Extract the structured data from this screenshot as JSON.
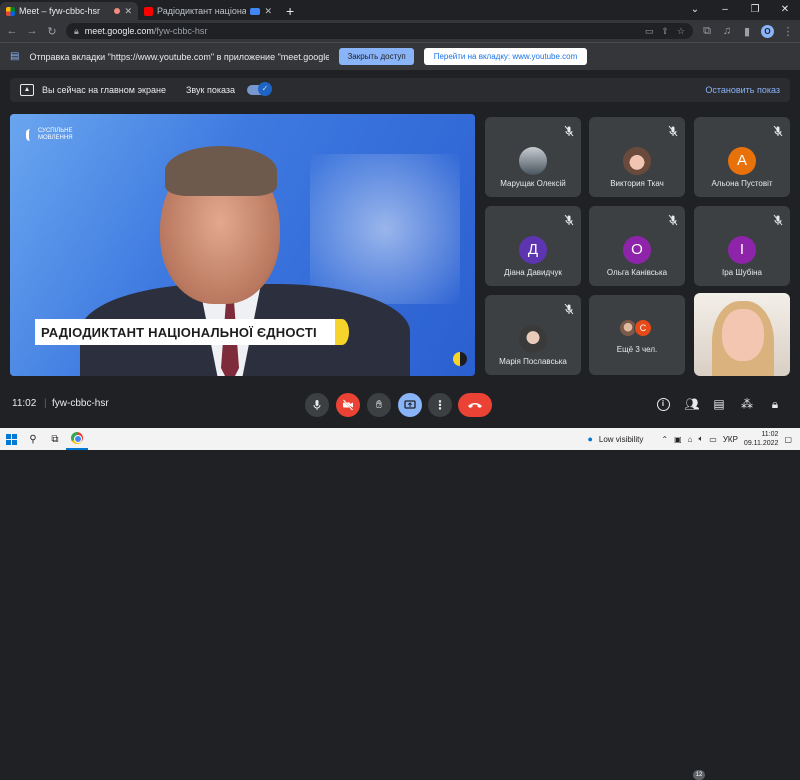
{
  "browser": {
    "tabs": [
      {
        "title": "Meet – fyw-cbbc-hsr",
        "active": true,
        "favicon": "meet-icon"
      },
      {
        "title": "Радіодиктант національної",
        "active": false,
        "favicon": "youtube-icon"
      }
    ],
    "new_tab_label": "+",
    "address": {
      "host": "meet.google.com",
      "path": "/fyw-cbbc-hsr"
    },
    "profile_initial": "O"
  },
  "infobar": {
    "message": "Отправка вкладки \"https://www.youtube.com\" в приложение \"meet.google.com\"...",
    "stop_label": "Закрыть доступ",
    "switch_label": "Перейти на вкладку: www.youtube.com"
  },
  "presenting": {
    "status": "Вы сейчас на главном экране",
    "audio_label": "Звук показа",
    "audio_on": true,
    "stop_label": "Остановить показ"
  },
  "stage": {
    "channel_logo": [
      "СУСПІЛЬНЕ",
      "МОВЛЕННЯ"
    ],
    "caption": "РАДІОДИКТАНТ НАЦІОНАЛЬНОЇ ЄДНОСТІ"
  },
  "participants": [
    {
      "name": "Марущак Олексій",
      "avatar": "photo",
      "color": "#5b6b7a",
      "muted": true
    },
    {
      "name": "Виктория Ткач",
      "avatar": "photo",
      "color": "#b08a7a",
      "muted": true
    },
    {
      "name": "Альона Пустовіт",
      "avatar": "А",
      "color": "#e8710a",
      "muted": true
    },
    {
      "name": "Діана Давидчук",
      "avatar": "Д",
      "color": "#5e35b1",
      "muted": true
    },
    {
      "name": "Ольга Канівська",
      "avatar": "О",
      "color": "#8e24aa",
      "muted": true
    },
    {
      "name": "Іра Шубіна",
      "avatar": "І",
      "color": "#8e24aa",
      "muted": true
    },
    {
      "name": "Марія Пославська",
      "avatar": "photo",
      "color": "#9a8a80",
      "muted": true
    }
  ],
  "more_tile": {
    "label": "Ещё 3 чел.",
    "avatar_letter": "С",
    "avatar_color": "#e64a19"
  },
  "controls": {
    "time": "11:02",
    "meeting_code": "fyw-cbbc-hsr",
    "people_count": "12"
  },
  "taskbar": {
    "low_visibility": "Low visibility",
    "language": "УКР",
    "time": "11:02",
    "date": "09.11.2022"
  },
  "colors": {
    "accent": "#8ab4f8",
    "danger": "#ea4335",
    "bg": "#202124",
    "tile": "#3c4043"
  }
}
